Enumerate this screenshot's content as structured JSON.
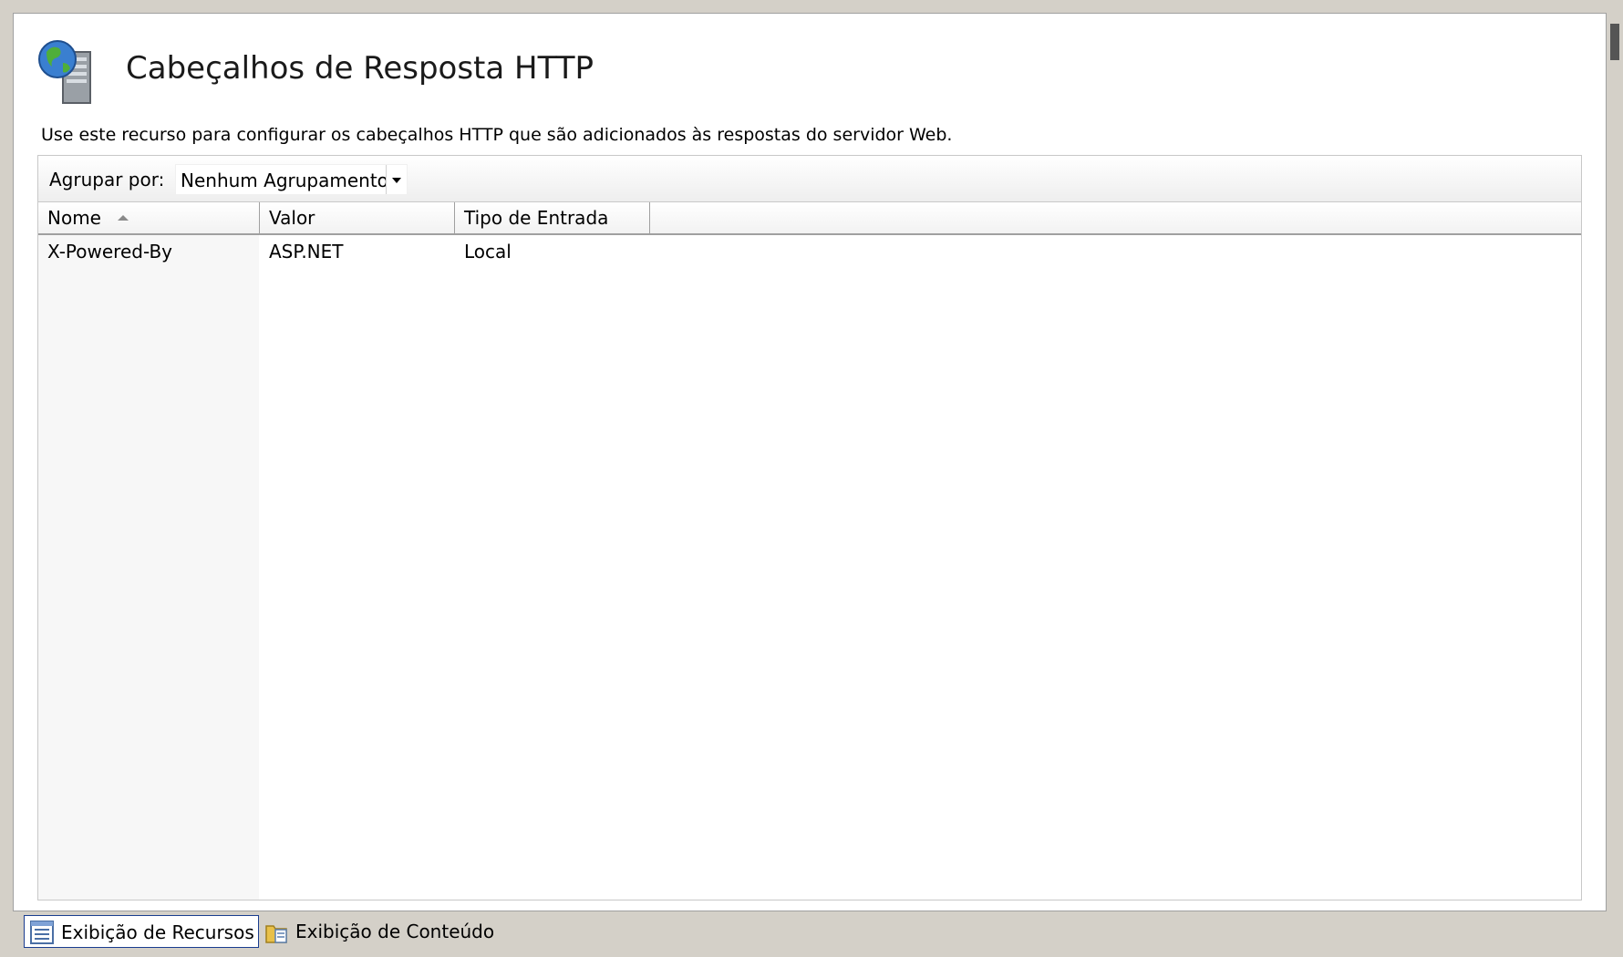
{
  "header": {
    "title": "Cabeçalhos de Resposta HTTP",
    "description": "Use este recurso para configurar os cabeçalhos HTTP que são adicionados às respostas do servidor Web.",
    "icon": "globe-server-icon"
  },
  "toolbar": {
    "group_by_label": "Agrupar por:",
    "group_by_value": "Nenhum Agrupamento"
  },
  "table": {
    "columns": [
      "Nome",
      "Valor",
      "Tipo de Entrada"
    ],
    "sorted_column": "Nome",
    "sort_direction": "ascending",
    "rows": [
      {
        "name": "X-Powered-By",
        "value": "ASP.NET",
        "entry_type": "Local"
      }
    ]
  },
  "tabs": [
    {
      "label": "Exibição de Recursos",
      "icon": "features-view-icon",
      "active": true
    },
    {
      "label": "Exibição de Conteúdo",
      "icon": "content-view-icon",
      "active": false
    }
  ],
  "colors": {
    "window_bg": "#d4d0c8",
    "panel_bg": "#ffffff",
    "active_tab_border": "#1a3d8f"
  }
}
